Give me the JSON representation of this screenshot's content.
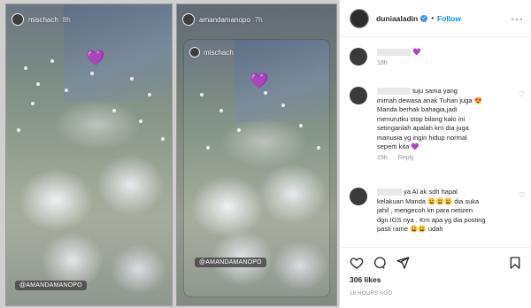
{
  "story_left": {
    "username": "mischach",
    "time": "8h",
    "tag": "@AMANDAMANOPO",
    "emoji": "💜"
  },
  "story_right": {
    "username": "amandamanopo",
    "time": "7h",
    "inner_username": "mischach",
    "tag": "@AMANDAMANOPO",
    "emoji": "💜"
  },
  "post": {
    "username": "duniaaladin",
    "follow_label": "Follow",
    "likes": "306 likes",
    "timestamp": "18 HOURS AGO"
  },
  "comments": [
    {
      "user": "",
      "text": "💜",
      "time": "18h",
      "reply": ""
    },
    {
      "user": "",
      "text": "tuju sama yang\ninimah dewasa anak Tuhan juga 😍\nManda berhak bahagia,jadi\nmenurutku stop bilang kalo ini\nsetinganlah apalah krn dia juga\nmanusia yg ingin hidup normal\nseperti kita 💜",
      "time": "15h",
      "reply": "Reply"
    },
    {
      "user": "",
      "text": "ya Al ak sdh hapal\nkelakuan Manda 😩😩😩 dia suka\njahil , mengecoh kn para netizen\ndgn IGS nya . Krn apa yg dia posting\npasti rame 😩😩 udah",
      "time": "",
      "reply": ""
    }
  ],
  "colors": {
    "accent": "#0095f6",
    "heart": "#9b5cf0",
    "muted": "#8e8e8e"
  }
}
